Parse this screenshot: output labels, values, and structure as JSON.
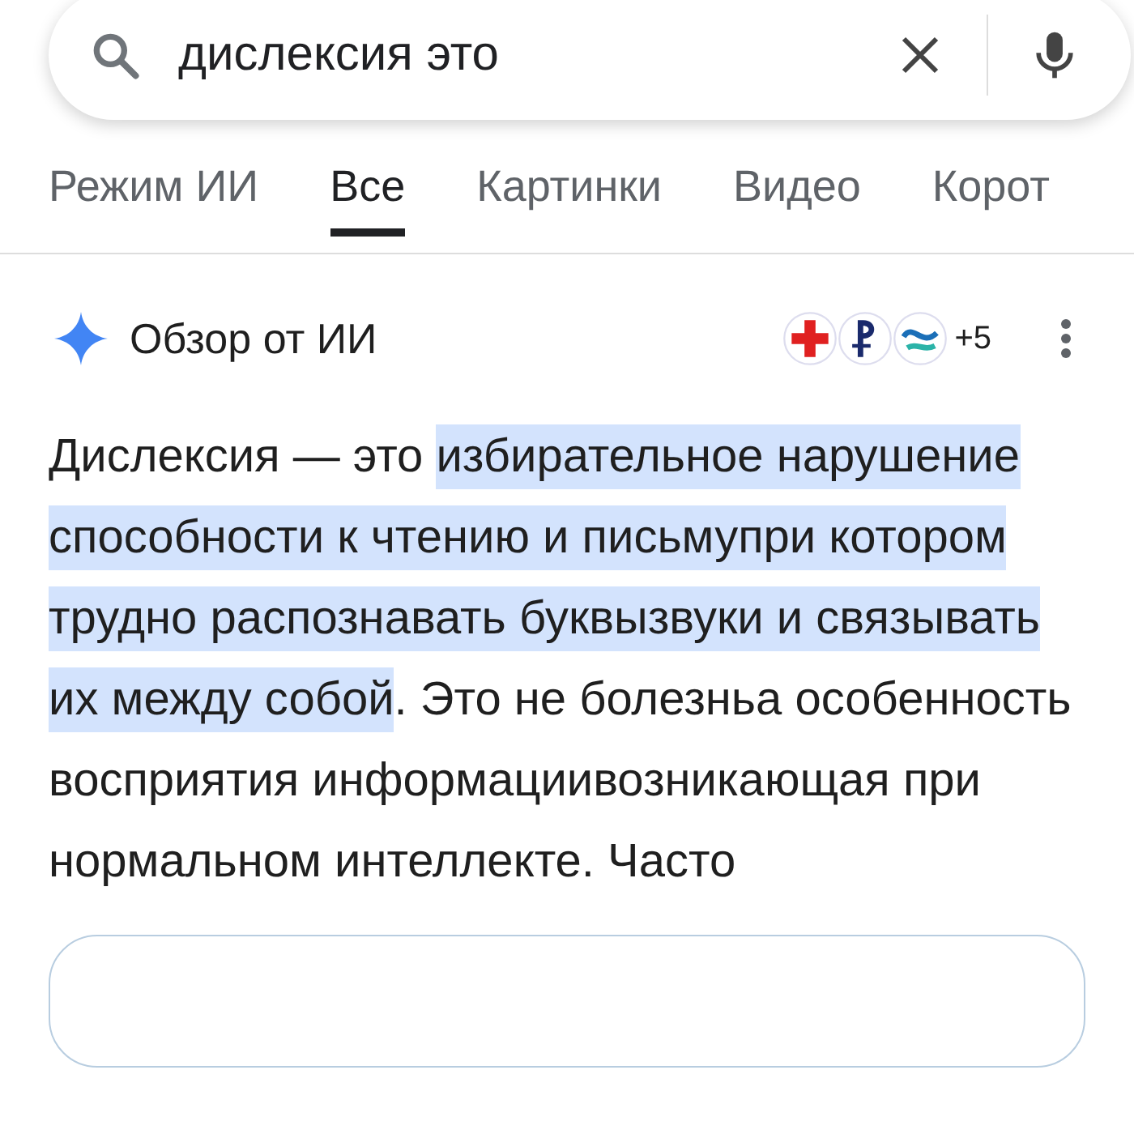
{
  "search": {
    "value": "дислексия это"
  },
  "tabs": [
    {
      "label": "Режим ИИ",
      "selected": false
    },
    {
      "label": "Все",
      "selected": true
    },
    {
      "label": "Картинки",
      "selected": false
    },
    {
      "label": "Видео",
      "selected": false
    },
    {
      "label": "Корот",
      "selected": false
    }
  ],
  "ai_overview": {
    "title": "Обзор от ИИ",
    "sources_more": "+5",
    "paragraph": [
      {
        "text": "Дислексия — это ",
        "highlighted": false
      },
      {
        "text": "избирательное нарушение способности к чтению и письмупри котором трудно распознавать буквызвуки и связывать их между собой",
        "highlighted": true
      },
      {
        "text": ". Это не болезнь",
        "highlighted": false
      },
      {
        "text": "а особенность восприятия информациивозникающая при нормальном интеллекте. Часто",
        "highlighted": false
      }
    ]
  }
}
